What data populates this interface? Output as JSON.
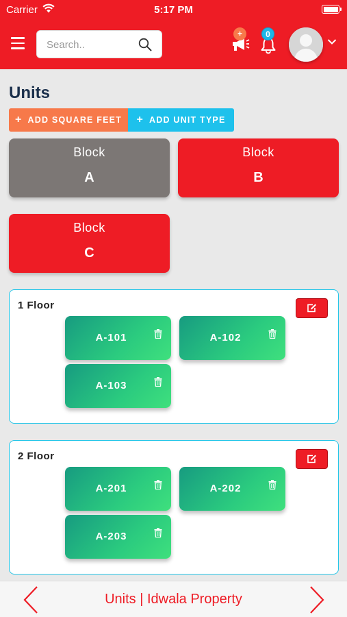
{
  "status_bar": {
    "carrier": "Carrier",
    "time": "5:17 PM"
  },
  "header": {
    "search_placeholder": "Search..",
    "announcement_badge": "+",
    "notification_count": "0"
  },
  "page": {
    "title": "Units",
    "add_square_feet_label": "ADD SQUARE FEET",
    "add_unit_type_label": "ADD UNIT TYPE"
  },
  "blocks": [
    {
      "label": "Block",
      "letter": "A",
      "color": "#7c7775"
    },
    {
      "label": "Block",
      "letter": "B",
      "color": "#ee1c25"
    },
    {
      "label": "Block",
      "letter": "C",
      "color": "#ee1c25"
    }
  ],
  "floors": [
    {
      "title": "1 Floor",
      "units": [
        "A-101",
        "A-102",
        "A-103"
      ]
    },
    {
      "title": "2 Floor",
      "units": [
        "A-201",
        "A-202",
        "A-203"
      ]
    }
  ],
  "footer": {
    "title": "Units | Idwala Property"
  },
  "colors": {
    "brand_red": "#ee1c25",
    "accent_orange": "#f7794a",
    "accent_cyan": "#1ec1ec",
    "tile_green_start": "#179b80",
    "tile_green_end": "#3fe07d"
  },
  "icons": [
    "wifi-icon",
    "battery-icon",
    "menu-icon",
    "search-icon",
    "megaphone-icon",
    "bell-icon",
    "avatar",
    "chevron-down-icon",
    "edit-icon",
    "trash-icon",
    "chevron-left-icon",
    "chevron-right-icon"
  ]
}
